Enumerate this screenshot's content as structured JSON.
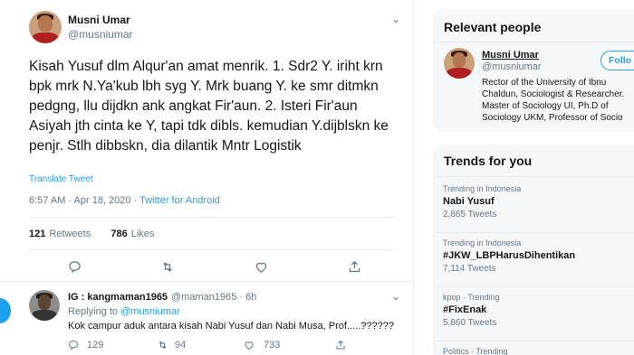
{
  "tweet": {
    "author_name": "Musni Umar",
    "author_handle": "@musniumar",
    "text": "Kisah Yusuf dlm Alqur'an amat menrik. 1. Sdr2 Y. iriht krn bpk mrk N.Ya'kub lbh syg Y. Mrk buang Y. ke smr ditmkn pedgng, llu dijdkn ank angkat Fir'aun. 2. Isteri Fir'aun Asiyah jth cinta ke Y, tapi tdk dibls. kemudian Y.dijblskn ke penjr. Stlh dibbskn, dia dilantik Mntr Logistik",
    "translate_label": "Translate Tweet",
    "time": "6:57 AM · Apr 18, 2020",
    "separator": " · ",
    "source": "Twitter for Android",
    "retweets_count": "121",
    "retweets_label": "Retweets",
    "likes_count": "786",
    "likes_label": "Likes"
  },
  "reply": {
    "author_name": "IG : kangmaman1965",
    "author_handle": "@maman1965 · 6h",
    "replying_prefix": "Replying to",
    "replying_handle": "@musniumar",
    "text": "Kok campur aduk antara kisah Nabi Yusuf dan Nabi Musa, Prof.....??????",
    "replies": "129",
    "retweets": "94",
    "likes": "733"
  },
  "relevant_people": {
    "title": "Relevant people",
    "name": "Musni Umar",
    "handle": "@musniumar",
    "follow_label": "Follo",
    "bio_lines": [
      "Rector of the University of Ibnu",
      "Chaldun, Sociologist & Researcher.",
      "Master of Sociology UI, Ph.D of",
      "Sociology UKM, Professor of Socio"
    ]
  },
  "trends": {
    "title": "Trends for you",
    "items": [
      {
        "context": "Trending in Indonesia",
        "name": "Nabi Yusuf",
        "count": "2,865 Tweets"
      },
      {
        "context": "Trending in Indonesia",
        "name": "#JKW_LBPHarusDihentikan",
        "count": "7,114 Tweets"
      },
      {
        "context": "kpop · Trending",
        "name": "#FixEnak",
        "count": "5,860 Tweets"
      },
      {
        "context": "Politics · Trending",
        "name": "",
        "count": ""
      }
    ]
  },
  "colors": {
    "accent": "#1da1f2",
    "secondary_text": "#657786",
    "background": "#e6ecf0"
  }
}
